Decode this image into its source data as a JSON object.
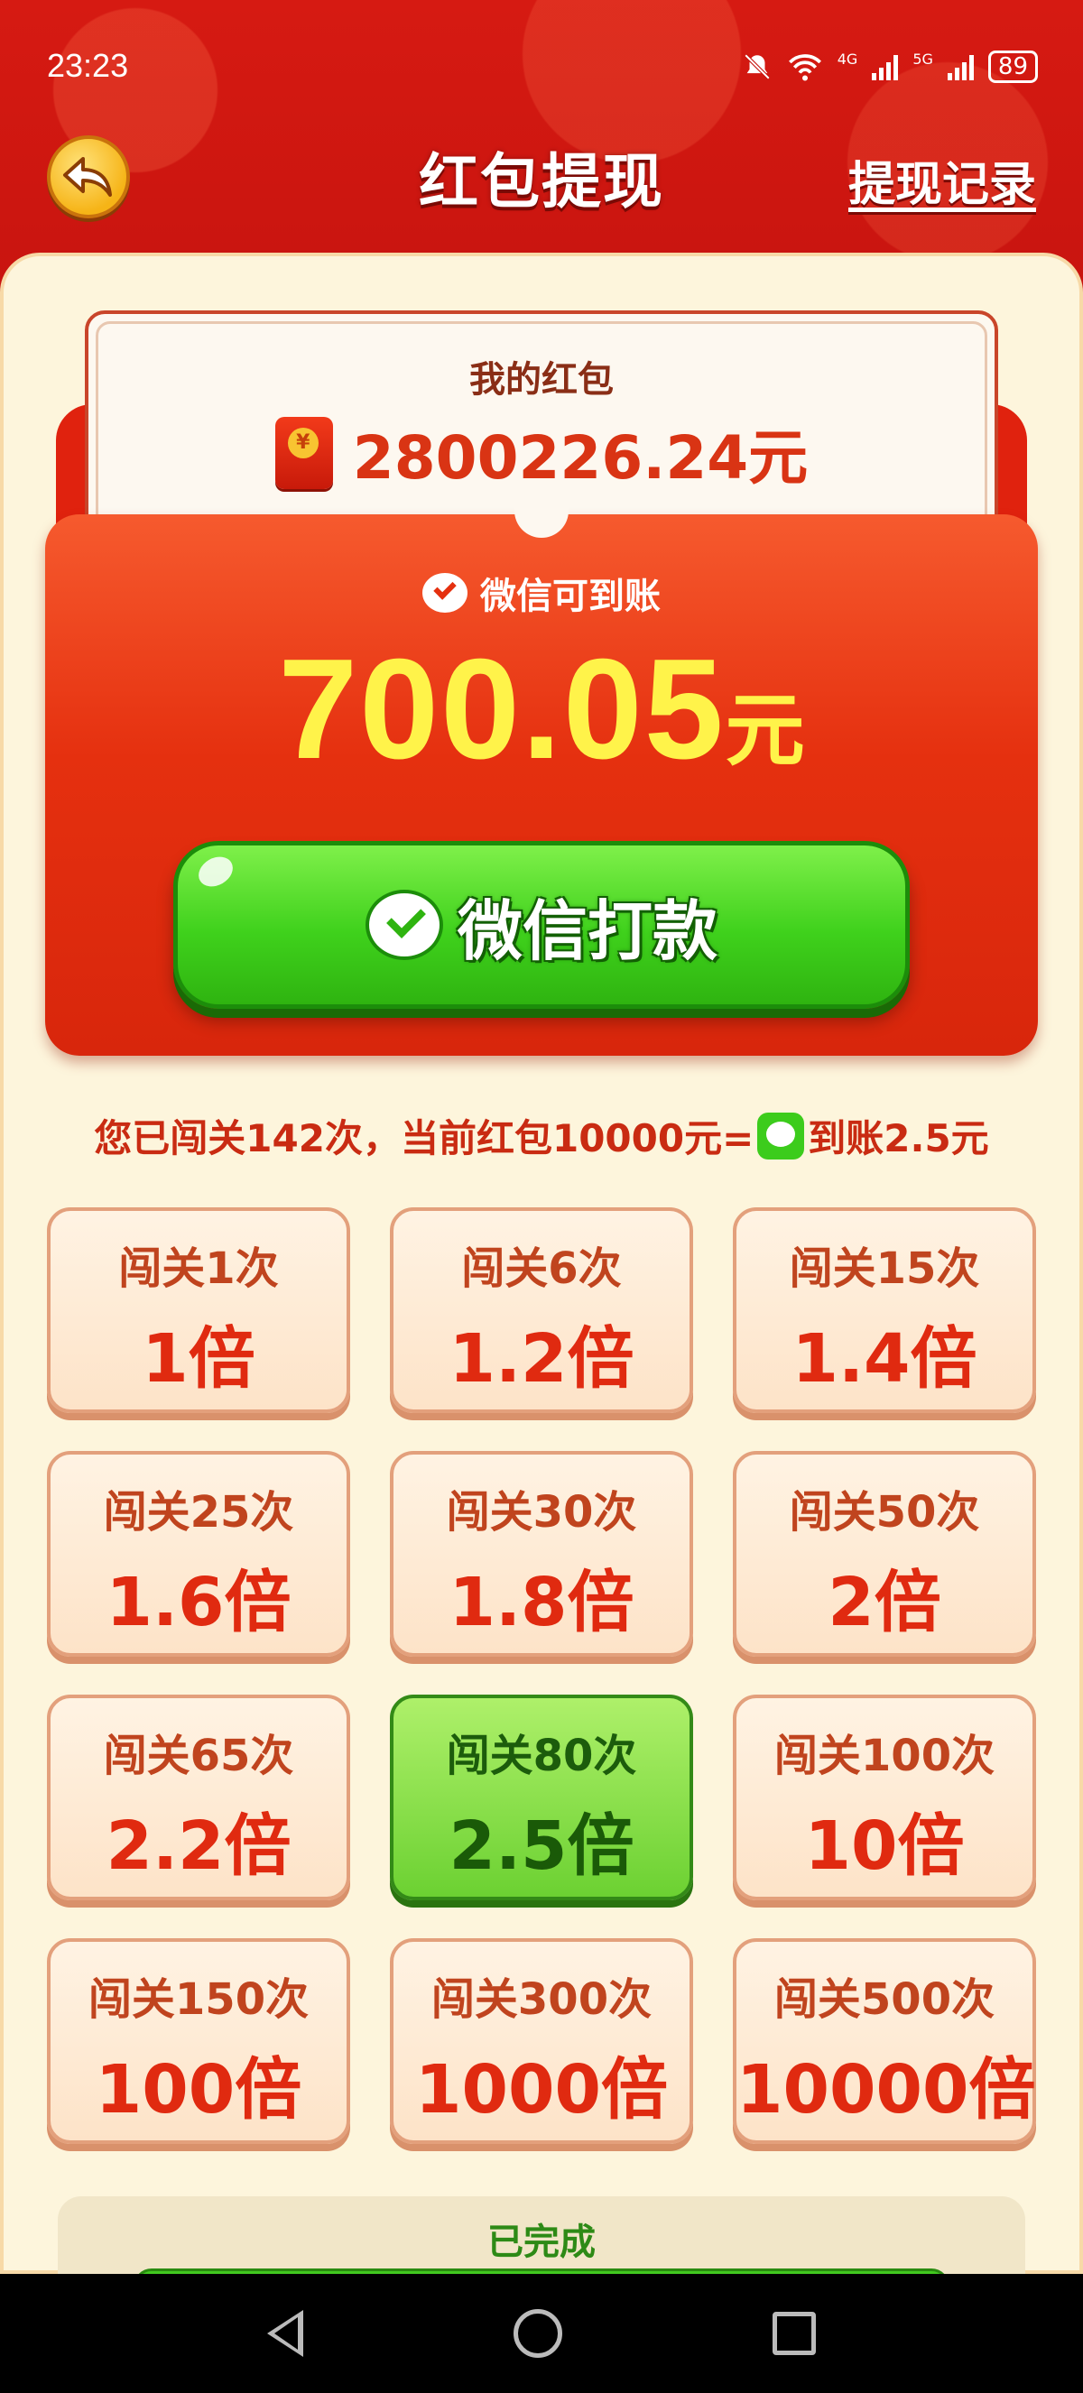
{
  "status_bar": {
    "time": "23:23",
    "network_4g": "4G",
    "network_5g": "5G",
    "battery": "89"
  },
  "header": {
    "title": "红包提现",
    "history_link": "提现记录"
  },
  "wallet": {
    "label": "我的红包",
    "amount": "2800226.24元"
  },
  "payout": {
    "label": "微信可到账",
    "amount": "700.05",
    "unit": "元",
    "button_label": "微信打款"
  },
  "info": {
    "prefix": "您已闯关142次，当前红包10000元=",
    "suffix": "到账2.5元"
  },
  "tiers": [
    {
      "label": "闯关1次",
      "multiplier": "1倍"
    },
    {
      "label": "闯关6次",
      "multiplier": "1.2倍"
    },
    {
      "label": "闯关15次",
      "multiplier": "1.4倍"
    },
    {
      "label": "闯关25次",
      "multiplier": "1.6倍"
    },
    {
      "label": "闯关30次",
      "multiplier": "1.8倍"
    },
    {
      "label": "闯关50次",
      "multiplier": "2倍"
    },
    {
      "label": "闯关65次",
      "multiplier": "2.2倍"
    },
    {
      "label": "闯关80次",
      "multiplier": "2.5倍"
    },
    {
      "label": "闯关100次",
      "multiplier": "10倍"
    },
    {
      "label": "闯关150次",
      "multiplier": "100倍"
    },
    {
      "label": "闯关300次",
      "multiplier": "1000倍"
    },
    {
      "label": "闯关500次",
      "multiplier": "10000倍"
    }
  ],
  "active_tier_index": 7,
  "done": {
    "label": "已完成"
  },
  "colors": {
    "header_red": "#c8140f",
    "accent_yellow": "#fff34a",
    "wechat_green": "#3fd11c",
    "panel_cream": "#fdf5dc"
  },
  "icons": [
    "back-arrow-icon",
    "wechat-icon",
    "hongbao-icon",
    "mute-icon",
    "wifi-icon",
    "signal-icon",
    "battery-icon"
  ]
}
